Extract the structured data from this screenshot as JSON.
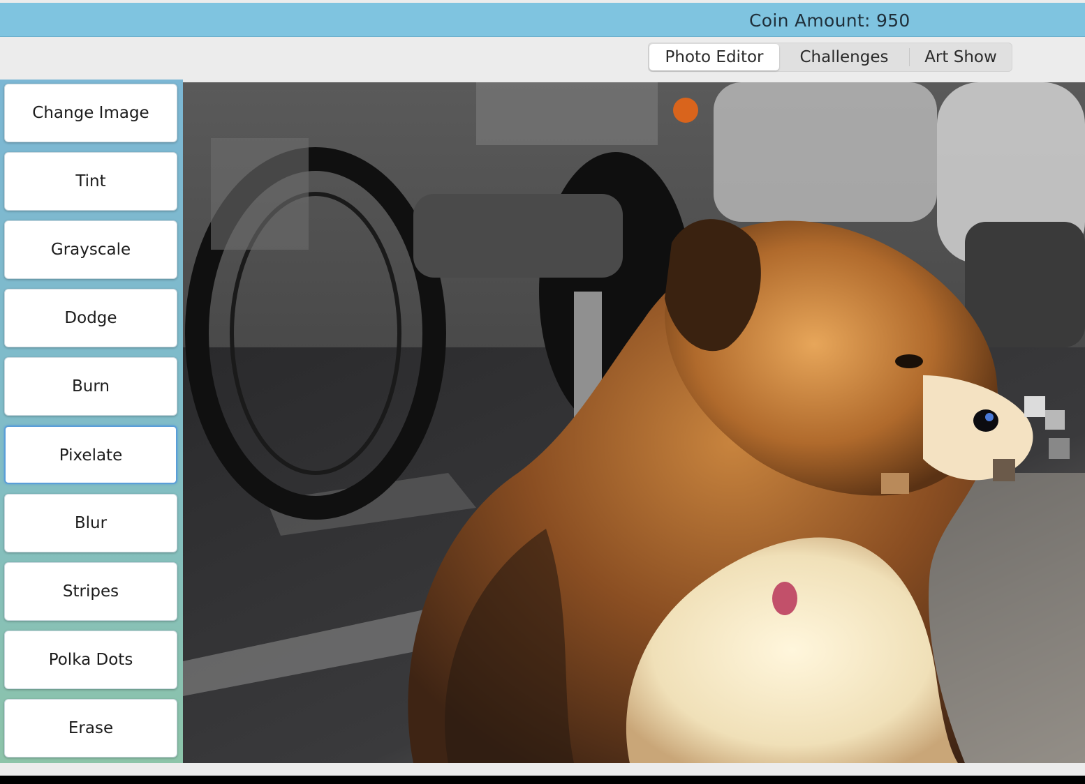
{
  "header": {
    "coin_label": "Coin Amount: 950"
  },
  "tabs": [
    {
      "label": "Photo Editor",
      "active": true
    },
    {
      "label": "Challenges",
      "active": false
    },
    {
      "label": "Art Show",
      "active": false
    }
  ],
  "tools": [
    {
      "label": "Change Image"
    },
    {
      "label": "Tint"
    },
    {
      "label": "Grayscale"
    },
    {
      "label": "Dodge"
    },
    {
      "label": "Burn"
    },
    {
      "label": "Pixelate",
      "selected": true
    },
    {
      "label": "Blur"
    },
    {
      "label": "Stripes"
    },
    {
      "label": "Polka Dots"
    },
    {
      "label": "Erase"
    }
  ],
  "canvas": {
    "content": "photo-of-dog"
  },
  "colors": {
    "coin_bar": "#7fc4e0",
    "sidebar_top": "#7cb7d4",
    "sidebar_bottom": "#8dc4a9",
    "selected_outline": "#5a9ed8"
  }
}
